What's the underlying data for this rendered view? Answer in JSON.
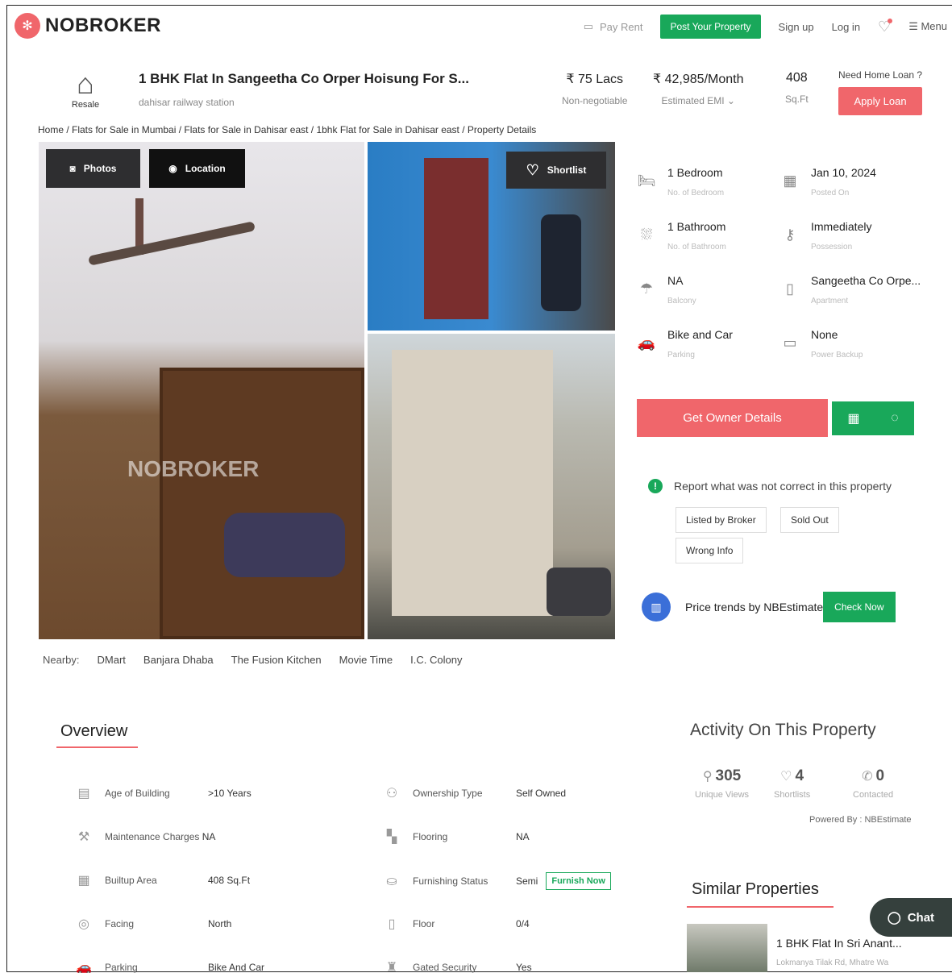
{
  "header": {
    "logo_text": "NOBROKER",
    "pay_rent": "Pay Rent",
    "post_property": "Post Your Property",
    "sign_up": "Sign up",
    "log_in": "Log in",
    "menu": "Menu"
  },
  "property": {
    "type_label": "Resale",
    "title": "1 BHK Flat In Sangeetha Co Orper Hoisung For S...",
    "subtitle": "dahisar railway station",
    "price": "₹ 75 Lacs",
    "price_note": "Non-negotiable",
    "emi": "₹ 42,985/Month",
    "emi_note": "Estimated EMI",
    "area": "408",
    "area_unit": "Sq.Ft",
    "loan_question": "Need Home Loan ?",
    "apply_loan": "Apply Loan"
  },
  "breadcrumb": "Home / Flats for Sale in Mumbai / Flats for Sale in Dahisar east / 1bhk Flat for Sale in Dahisar east / Property Details",
  "gallery": {
    "photos": "Photos",
    "location": "Location",
    "shortlist": "Shortlist",
    "watermark": "NOBROKER"
  },
  "nearby": {
    "label": "Nearby:",
    "places": [
      "DMart",
      "Banjara Dhaba",
      "The Fusion Kitchen",
      "Movie Time",
      "I.C. Colony"
    ]
  },
  "details": [
    {
      "value": "1 Bedroom",
      "label": "No. of Bedroom",
      "icon": "bed-icon"
    },
    {
      "value": "Jan 10, 2024",
      "label": "Posted On",
      "icon": "calendar-icon"
    },
    {
      "value": "1 Bathroom",
      "label": "No. of Bathroom",
      "icon": "bath-icon"
    },
    {
      "value": "Immediately",
      "label": "Possession",
      "icon": "key-icon"
    },
    {
      "value": "NA",
      "label": "Balcony",
      "icon": "balcony-icon"
    },
    {
      "value": "Sangeetha Co Orpe...",
      "label": "Apartment",
      "icon": "building-icon"
    },
    {
      "value": "Bike and Car",
      "label": "Parking",
      "icon": "car-icon"
    },
    {
      "value": "None",
      "label": "Power Backup",
      "icon": "battery-icon"
    }
  ],
  "actions": {
    "get_owner": "Get Owner Details",
    "report_text": "Report what was not correct in this property",
    "chips": [
      "Listed by Broker",
      "Sold Out",
      "Wrong Info"
    ],
    "price_trends": "Price trends by NBEstimate",
    "check_now": "Check Now"
  },
  "overview": {
    "title": "Overview",
    "left": [
      {
        "key": "Age of Building",
        "value": ">10 Years",
        "icon": "building-age-icon"
      },
      {
        "key": "Maintenance Charges",
        "value": "NA",
        "icon": "tools-icon"
      },
      {
        "key": "Builtup Area",
        "value": "408 Sq.Ft",
        "icon": "area-icon"
      },
      {
        "key": "Facing",
        "value": "North",
        "icon": "compass-icon"
      },
      {
        "key": "Parking",
        "value": "Bike And Car",
        "icon": "car-icon"
      }
    ],
    "right": [
      {
        "key": "Ownership Type",
        "value": "Self Owned",
        "icon": "ownership-icon"
      },
      {
        "key": "Flooring",
        "value": "NA",
        "icon": "flooring-icon"
      },
      {
        "key": "Furnishing Status",
        "value": "Semi",
        "icon": "sofa-icon"
      },
      {
        "key": "Floor",
        "value": "0/4",
        "icon": "floor-icon"
      },
      {
        "key": "Gated Security",
        "value": "Yes",
        "icon": "guard-icon"
      }
    ],
    "furnish_now": "Furnish Now"
  },
  "activity": {
    "title": "Activity On This Property",
    "views": "305",
    "views_label": "Unique Views",
    "shortlists": "4",
    "shortlists_label": "Shortlists",
    "contacted": "0",
    "contacted_label": "Contacted",
    "powered": "Powered By : NBEstimate"
  },
  "similar": {
    "title": "Similar Properties",
    "item_title": "1 BHK Flat In Sri Anant...",
    "item_sub": "Lokmanya Tilak Rd, Mhatre Wa"
  },
  "chat": "Chat",
  "colors": {
    "accent_red": "#f0666b",
    "accent_green": "#19a85a"
  }
}
